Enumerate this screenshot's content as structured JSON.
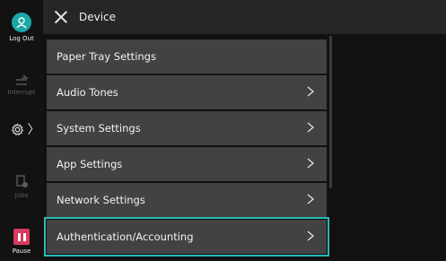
{
  "sidebar": {
    "logout_label": "Log Out",
    "interrupt_label": "Interrupt",
    "jobs_label": "Jobs",
    "pause_label": "Pause"
  },
  "header": {
    "title": "Device"
  },
  "menu": {
    "items": [
      {
        "label": "Paper Tray Settings"
      },
      {
        "label": "Audio Tones"
      },
      {
        "label": "System Settings"
      },
      {
        "label": "App Settings"
      },
      {
        "label": "Network Settings"
      },
      {
        "label": "Authentication/Accounting"
      }
    ],
    "selected_item": "Authentication/Accounting"
  },
  "colors": {
    "accent": "#1aa7a6",
    "pause": "#d93a60",
    "selection_outline": "#2ab9b6"
  }
}
